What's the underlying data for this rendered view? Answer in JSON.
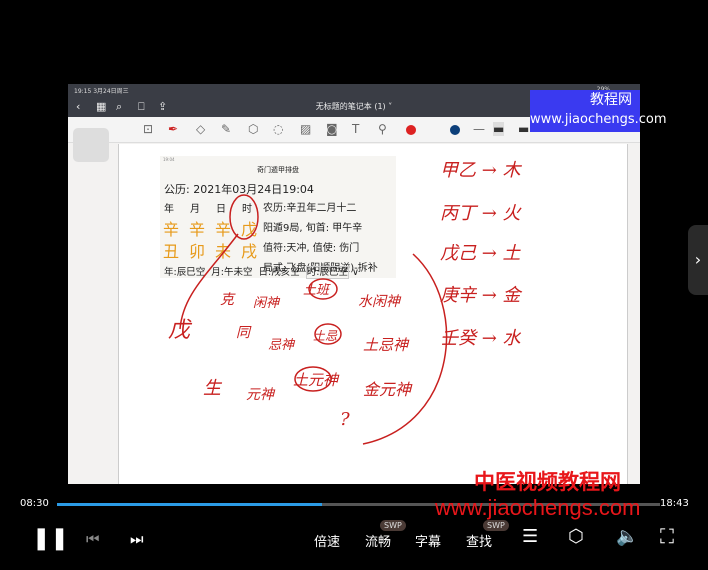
{
  "status_bar": {
    "time": "19:15",
    "date": "3月24日周三",
    "battery": "29%"
  },
  "notes_app": {
    "title": "无标题的笔记本 (1)"
  },
  "watermark_top": {
    "line1": "教程网",
    "line2": "www.jiaochengs.com"
  },
  "qimen_card": {
    "title": "奇门遁甲排盘",
    "solar": "公历: 2021年03月24日19:04",
    "pillar_headers": [
      "年",
      "月",
      "日",
      "时"
    ],
    "stems": [
      "辛",
      "辛",
      "辛",
      "戊"
    ],
    "branches": [
      "丑",
      "卯",
      "未",
      "戌"
    ],
    "lunar": "农历:辛丑年二月十二",
    "ju": "阳遁9局, 旬首: 甲午辛",
    "zhifu": "值符:天冲, 值使: 伤门",
    "jushi": "局式:飞盘(阳顺阴逆)-拆补",
    "kong": [
      "年:辰巳空",
      "月:午未空",
      "日:戌亥空",
      "时:辰巳空"
    ]
  },
  "handwriting": {
    "right": [
      "甲乙 → 木",
      "丙丁 → 火",
      "戊己 → 土",
      "庚辛 → 金",
      "壬癸 → 水"
    ],
    "left": [
      "戊",
      "克",
      "闲神",
      "土班",
      "水闲神",
      "同",
      "忌神",
      "土忌",
      "土忌神",
      "生",
      "元神",
      "土元神",
      "金元神",
      "?"
    ]
  },
  "player": {
    "current_time": "08:30",
    "end_time": "18:43",
    "progress": 0.44,
    "buttons": [
      "倍速",
      "流畅",
      "字幕",
      "查找"
    ],
    "badge": "SWP",
    "accent": "#2b9be6"
  },
  "watermark_bottom": {
    "line1": "中医视频教程网",
    "line2": "www.jiaochengs.com"
  }
}
